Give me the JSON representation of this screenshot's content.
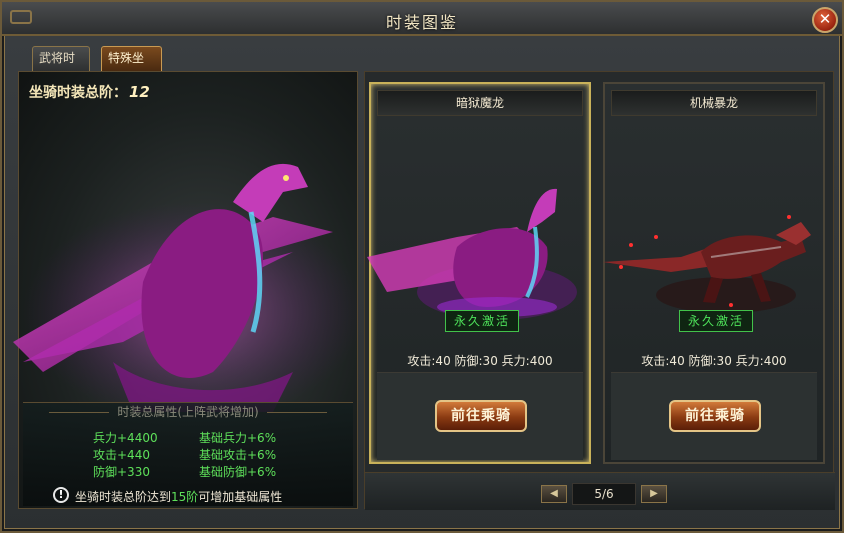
{
  "window": {
    "title": "时装图鉴",
    "close_symbol": "✕"
  },
  "tabs": [
    {
      "label": "武将时装",
      "active": false
    },
    {
      "label": "特殊坐骑",
      "active": true
    }
  ],
  "left_panel": {
    "total_stage_label": "坐骑时装总阶：",
    "total_stage_value": "12",
    "attr_title": "时装总属性(上阵武将增加)",
    "attributes": [
      {
        "left": "兵力+4400",
        "right": "基础兵力+6%"
      },
      {
        "left": "攻击+440",
        "right": "基础攻击+6%"
      },
      {
        "left": "防御+330",
        "right": "基础防御+6%"
      }
    ],
    "tip_prefix": "坐骑时装总阶达到",
    "tip_highlight": "15阶",
    "tip_suffix": "可增加基础属性",
    "tip_icon": "exclamation-icon"
  },
  "cards": [
    {
      "name": "暗狱魔龙",
      "badge": "永久激活",
      "stats": "攻击:40 防御:30 兵力:400",
      "button": "前往乘骑",
      "selected": true
    },
    {
      "name": "机械暴龙",
      "badge": "永久激活",
      "stats": "攻击:40 防御:30 兵力:400",
      "button": "前往乘骑",
      "selected": false
    }
  ],
  "pager": {
    "prev_symbol": "◀",
    "next_symbol": "▶",
    "current": "5/6"
  },
  "colors": {
    "accent_gold": "#c9b25a",
    "status_green": "#4ee35a",
    "button_orange": "#d27a3a"
  }
}
